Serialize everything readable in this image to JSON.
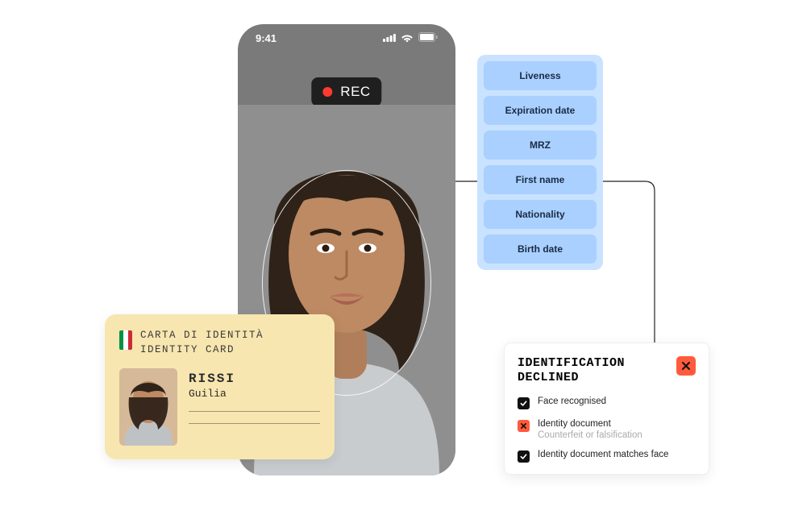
{
  "phone": {
    "time": "9:41",
    "rec_label": "REC"
  },
  "id_card": {
    "title_local": "CARTA DI IDENTITÀ",
    "title_en": "IDENTITY CARD",
    "surname": "RISSI",
    "firstname": "Guilia"
  },
  "checks": {
    "items": [
      "Liveness",
      "Expiration date",
      "MRZ",
      "First name",
      "Nationality",
      "Birth date"
    ]
  },
  "result": {
    "title_line1": "IDENTIFICATION",
    "title_line2": "DECLINED",
    "rows": [
      {
        "status": "ok",
        "label": "Face recognised",
        "sub": ""
      },
      {
        "status": "fail",
        "label": "Identity document",
        "sub": "Counterfeit or falsification"
      },
      {
        "status": "ok",
        "label": "Identity document matches face",
        "sub": ""
      }
    ]
  }
}
